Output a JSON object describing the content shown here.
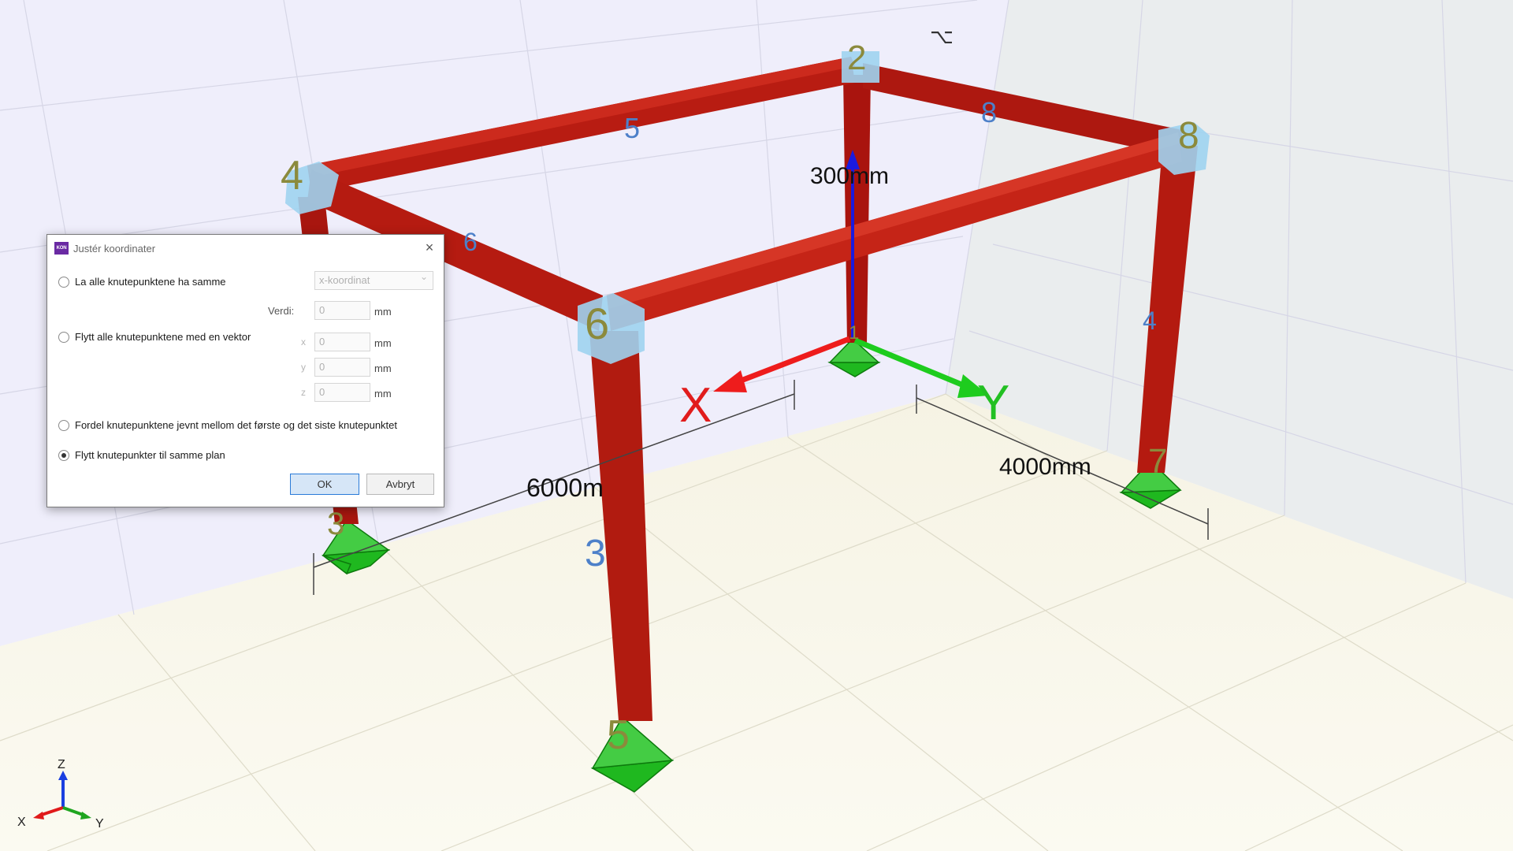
{
  "scene": {
    "nodes": [
      "1",
      "2",
      "3",
      "4",
      "5",
      "6",
      "7",
      "8"
    ],
    "members": [
      "3",
      "4",
      "5",
      "6",
      "8"
    ],
    "dimensions": {
      "height": "300mm",
      "length_x": "6000m",
      "length_y": "4000mm"
    },
    "axis_labels": {
      "x": "X",
      "y": "Y",
      "z": "Z"
    },
    "colors": {
      "beam": "#b11b10",
      "support": "#19b219",
      "node": "#9fd3ef",
      "node_label": "#8b8a3c",
      "member_label": "#4d80c9"
    }
  },
  "triad": {
    "x": "X",
    "y": "Y",
    "z": "Z"
  },
  "dialog": {
    "icon_text": "KON",
    "title": "Justér koordinater",
    "close_icon": "×",
    "option1": {
      "label": "La alle knutepunktene ha samme",
      "select_value": "x-koordinat",
      "value_label": "Verdi:",
      "value": "0",
      "unit": "mm"
    },
    "option2": {
      "label": "Flytt alle knutepunktene med en vektor",
      "x_label": "x",
      "x_value": "0",
      "y_label": "y",
      "y_value": "0",
      "z_label": "z",
      "z_value": "0",
      "unit": "mm"
    },
    "option3": {
      "label": "Fordel knutepunktene jevnt mellom det første og det siste knutepunktet"
    },
    "option4": {
      "label": "Flytt knutepunkter til samme plan",
      "checked": true
    },
    "ok_label": "OK",
    "cancel_label": "Avbryt"
  }
}
